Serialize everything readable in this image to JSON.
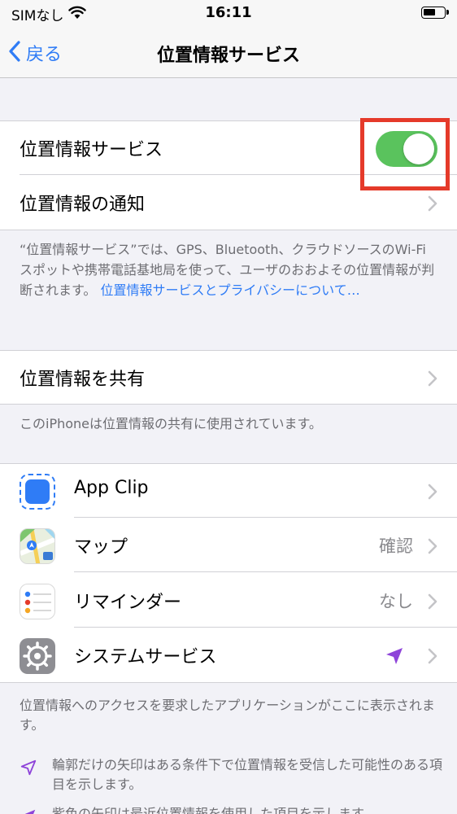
{
  "status_bar": {
    "carrier": "SIMなし",
    "time": "16:11"
  },
  "nav": {
    "back_label": "戻る",
    "title": "位置情報サービス"
  },
  "main_group": {
    "location_services_label": "位置情報サービス",
    "location_services_enabled": true,
    "alerts_label": "位置情報の通知"
  },
  "description": {
    "text": "“位置情報サービス”では、GPS、Bluetooth、クラウドソースのWi-Fiスポットや携帯電話基地局を使って、ユーザのおおよその位置情報が判断されます。",
    "link": "位置情報サービスとプライバシーについて…"
  },
  "share_group": {
    "label": "位置情報を共有"
  },
  "share_note": "このiPhoneは位置情報の共有に使用されています。",
  "apps": [
    {
      "name": "App Clip",
      "value": ""
    },
    {
      "name": "マップ",
      "value": "確認"
    },
    {
      "name": "リマインダー",
      "value": "なし"
    },
    {
      "name": "システムサービス",
      "value": ""
    }
  ],
  "apps_note": "位置情報へのアクセスを要求したアプリケーションがここに表示されます。",
  "legend": [
    {
      "icon": "hollow-arrow-icon",
      "text": "輪郭だけの矢印はある条件下で位置情報を受信した可能性のある項目を示します。"
    },
    {
      "icon": "purple-arrow-icon",
      "text": "紫色の矢印は最近位置情報を使用した項目を示します。"
    }
  ],
  "colors": {
    "accent": "#2f7cf6",
    "toggle_on": "#5ac35d",
    "highlight": "#e53a2a",
    "recent_arrow": "#8e44d9"
  }
}
